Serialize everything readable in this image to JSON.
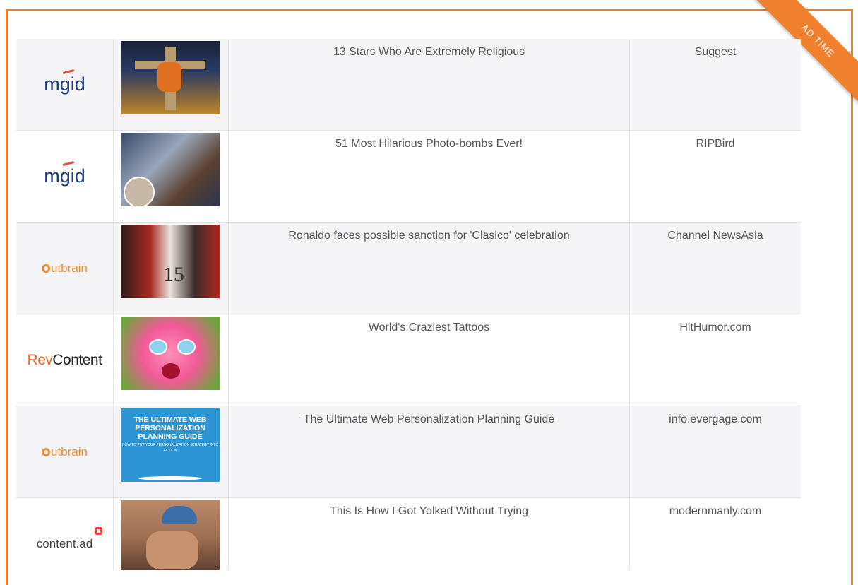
{
  "badge": {
    "label": "AD TIME"
  },
  "rows": [
    {
      "network": "mgid",
      "title": "13 Stars Who Are Extremely Religious",
      "source": "Suggest"
    },
    {
      "network": "mgid",
      "title": "51 Most Hilarious Photo-bombs Ever!",
      "source": "RIPBird"
    },
    {
      "network": "Outbrain",
      "title": "Ronaldo faces possible sanction for 'Clasico' celebration",
      "source": "Channel NewsAsia"
    },
    {
      "network": "RevContent",
      "title": "World's Craziest Tattoos",
      "source": "HitHumor.com"
    },
    {
      "network": "Outbrain",
      "title": "The Ultimate Web Personalization Planning Guide",
      "source": "info.evergage.com"
    },
    {
      "network": "content.ad",
      "title": "This Is How I Got Yolked Without Trying",
      "source": "modernmanly.com"
    }
  ],
  "logos": {
    "mgid": "mgid",
    "outbrain": "utbrain",
    "rev_prefix": "Rev",
    "rev_suffix": "Content",
    "contentad": "content.ad"
  },
  "thumb3_number": "15",
  "thumb5": {
    "lines": [
      "THE ULTIMATE WEB",
      "PERSONALIZATION",
      "PLANNING GUIDE"
    ],
    "sub": "HOW TO PUT YOUR PERSONALIZATION STRATEGY INTO ACTION"
  },
  "colors": {
    "accent": "#f07f2e",
    "mgid": "#1d3e7c",
    "outbrain": "#f08a30",
    "rev": "#e8672a"
  }
}
